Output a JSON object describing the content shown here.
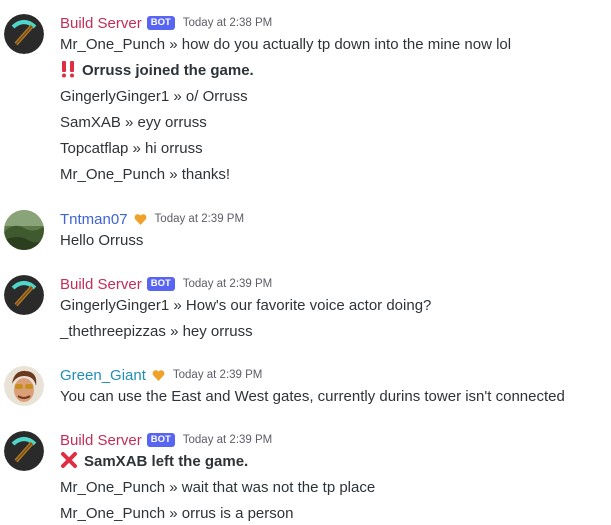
{
  "colors": {
    "build_server": "#c22e56",
    "tntman": "#3e63d6",
    "green_giant": "#1f8fb6",
    "bot_badge": "#5865f2",
    "heart": "#f0a12a"
  },
  "messages": [
    {
      "author": "Build Server",
      "bot": "BOT",
      "time": "Today at 2:38 PM",
      "avatar_icon": "pickaxe-icon",
      "lines": [
        "Mr_One_Punch »  how do you actually tp down into the mine now lol",
        "Orruss joined the game.",
        "GingerlyGinger1 »  o/ Orruss",
        "SamXAB »  eyy orruss",
        "Topcatflap »  hi orruss",
        "Mr_One_Punch »  thanks!"
      ]
    },
    {
      "author": "Tntman07",
      "time": "Today at 2:39 PM",
      "avatar_icon": "landscape-avatar",
      "lines": [
        "Hello Orruss"
      ]
    },
    {
      "author": "Build Server",
      "bot": "BOT",
      "time": "Today at 2:39 PM",
      "avatar_icon": "pickaxe-icon",
      "lines": [
        "GingerlyGinger1 »  How's our favorite voice actor doing?",
        "_thethreepizzas »  hey orruss"
      ]
    },
    {
      "author": "Green_Giant",
      "time": "Today at 2:39 PM",
      "avatar_icon": "face-avatar",
      "lines": [
        "You can use the East and West gates, currently durins tower isn't connected"
      ]
    },
    {
      "author": "Build Server",
      "bot": "BOT",
      "time": "Today at 2:39 PM",
      "avatar_icon": "pickaxe-icon",
      "lines": [
        "SamXAB left the game.",
        "Mr_One_Punch »  wait that was not the tp place",
        "Mr_One_Punch »  orrus is a person"
      ]
    }
  ]
}
